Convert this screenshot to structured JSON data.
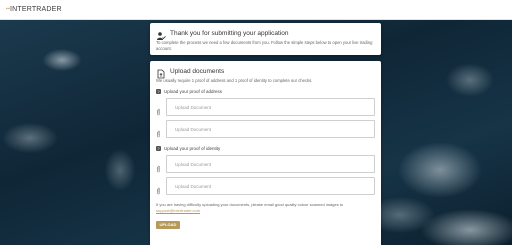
{
  "brand": {
    "mark": "▪▪",
    "name": "INTERTRADER"
  },
  "thanks_card": {
    "title": "Thank you for submitting your application",
    "text": "To complete the process we need a few documents from you. Follow the simple steps below to open your live trading account."
  },
  "upload_card": {
    "title": "Upload documents",
    "intro": "We usually require 1 proof of address and 1 proof of identity to complete our checks.",
    "address": {
      "label": "Upload your proof of address",
      "fields": [
        {
          "placeholder": "Upload Document"
        },
        {
          "placeholder": "Upload Document"
        }
      ]
    },
    "identity": {
      "label": "Upload your proof of identity",
      "fields": [
        {
          "placeholder": "Upload Document"
        },
        {
          "placeholder": "Upload Document"
        }
      ]
    },
    "footnote": "If you are having difficulty uploading your documents, please email good quality colour scanned images to",
    "support_email": "support@intertrader.com",
    "upload_button": "UPLOAD"
  },
  "colors": {
    "accent": "#b59a5a",
    "background": "#0e2233"
  }
}
